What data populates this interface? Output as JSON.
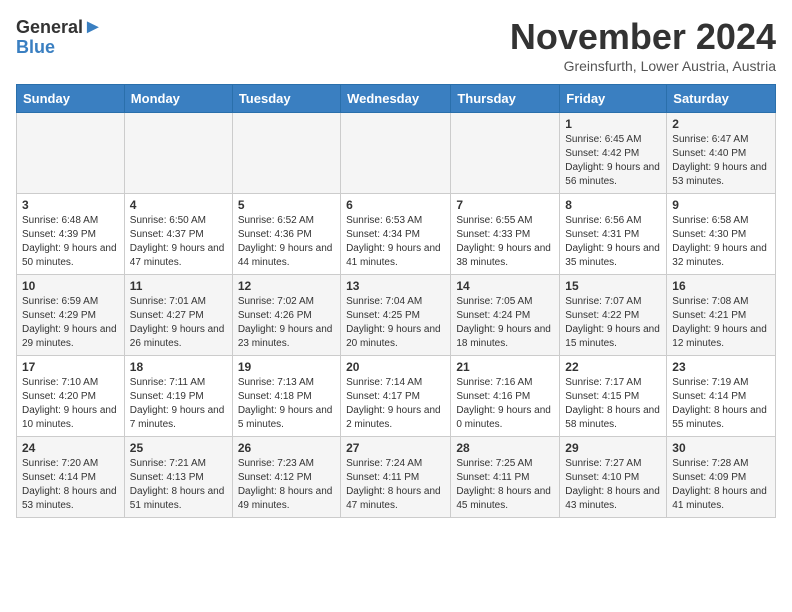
{
  "logo": {
    "line1": "General",
    "line2": "Blue"
  },
  "title": "November 2024",
  "subtitle": "Greinsfurth, Lower Austria, Austria",
  "headers": [
    "Sunday",
    "Monday",
    "Tuesday",
    "Wednesday",
    "Thursday",
    "Friday",
    "Saturday"
  ],
  "weeks": [
    [
      {
        "day": "",
        "info": ""
      },
      {
        "day": "",
        "info": ""
      },
      {
        "day": "",
        "info": ""
      },
      {
        "day": "",
        "info": ""
      },
      {
        "day": "",
        "info": ""
      },
      {
        "day": "1",
        "info": "Sunrise: 6:45 AM\nSunset: 4:42 PM\nDaylight: 9 hours and 56 minutes."
      },
      {
        "day": "2",
        "info": "Sunrise: 6:47 AM\nSunset: 4:40 PM\nDaylight: 9 hours and 53 minutes."
      }
    ],
    [
      {
        "day": "3",
        "info": "Sunrise: 6:48 AM\nSunset: 4:39 PM\nDaylight: 9 hours and 50 minutes."
      },
      {
        "day": "4",
        "info": "Sunrise: 6:50 AM\nSunset: 4:37 PM\nDaylight: 9 hours and 47 minutes."
      },
      {
        "day": "5",
        "info": "Sunrise: 6:52 AM\nSunset: 4:36 PM\nDaylight: 9 hours and 44 minutes."
      },
      {
        "day": "6",
        "info": "Sunrise: 6:53 AM\nSunset: 4:34 PM\nDaylight: 9 hours and 41 minutes."
      },
      {
        "day": "7",
        "info": "Sunrise: 6:55 AM\nSunset: 4:33 PM\nDaylight: 9 hours and 38 minutes."
      },
      {
        "day": "8",
        "info": "Sunrise: 6:56 AM\nSunset: 4:31 PM\nDaylight: 9 hours and 35 minutes."
      },
      {
        "day": "9",
        "info": "Sunrise: 6:58 AM\nSunset: 4:30 PM\nDaylight: 9 hours and 32 minutes."
      }
    ],
    [
      {
        "day": "10",
        "info": "Sunrise: 6:59 AM\nSunset: 4:29 PM\nDaylight: 9 hours and 29 minutes."
      },
      {
        "day": "11",
        "info": "Sunrise: 7:01 AM\nSunset: 4:27 PM\nDaylight: 9 hours and 26 minutes."
      },
      {
        "day": "12",
        "info": "Sunrise: 7:02 AM\nSunset: 4:26 PM\nDaylight: 9 hours and 23 minutes."
      },
      {
        "day": "13",
        "info": "Sunrise: 7:04 AM\nSunset: 4:25 PM\nDaylight: 9 hours and 20 minutes."
      },
      {
        "day": "14",
        "info": "Sunrise: 7:05 AM\nSunset: 4:24 PM\nDaylight: 9 hours and 18 minutes."
      },
      {
        "day": "15",
        "info": "Sunrise: 7:07 AM\nSunset: 4:22 PM\nDaylight: 9 hours and 15 minutes."
      },
      {
        "day": "16",
        "info": "Sunrise: 7:08 AM\nSunset: 4:21 PM\nDaylight: 9 hours and 12 minutes."
      }
    ],
    [
      {
        "day": "17",
        "info": "Sunrise: 7:10 AM\nSunset: 4:20 PM\nDaylight: 9 hours and 10 minutes."
      },
      {
        "day": "18",
        "info": "Sunrise: 7:11 AM\nSunset: 4:19 PM\nDaylight: 9 hours and 7 minutes."
      },
      {
        "day": "19",
        "info": "Sunrise: 7:13 AM\nSunset: 4:18 PM\nDaylight: 9 hours and 5 minutes."
      },
      {
        "day": "20",
        "info": "Sunrise: 7:14 AM\nSunset: 4:17 PM\nDaylight: 9 hours and 2 minutes."
      },
      {
        "day": "21",
        "info": "Sunrise: 7:16 AM\nSunset: 4:16 PM\nDaylight: 9 hours and 0 minutes."
      },
      {
        "day": "22",
        "info": "Sunrise: 7:17 AM\nSunset: 4:15 PM\nDaylight: 8 hours and 58 minutes."
      },
      {
        "day": "23",
        "info": "Sunrise: 7:19 AM\nSunset: 4:14 PM\nDaylight: 8 hours and 55 minutes."
      }
    ],
    [
      {
        "day": "24",
        "info": "Sunrise: 7:20 AM\nSunset: 4:14 PM\nDaylight: 8 hours and 53 minutes."
      },
      {
        "day": "25",
        "info": "Sunrise: 7:21 AM\nSunset: 4:13 PM\nDaylight: 8 hours and 51 minutes."
      },
      {
        "day": "26",
        "info": "Sunrise: 7:23 AM\nSunset: 4:12 PM\nDaylight: 8 hours and 49 minutes."
      },
      {
        "day": "27",
        "info": "Sunrise: 7:24 AM\nSunset: 4:11 PM\nDaylight: 8 hours and 47 minutes."
      },
      {
        "day": "28",
        "info": "Sunrise: 7:25 AM\nSunset: 4:11 PM\nDaylight: 8 hours and 45 minutes."
      },
      {
        "day": "29",
        "info": "Sunrise: 7:27 AM\nSunset: 4:10 PM\nDaylight: 8 hours and 43 minutes."
      },
      {
        "day": "30",
        "info": "Sunrise: 7:28 AM\nSunset: 4:09 PM\nDaylight: 8 hours and 41 minutes."
      }
    ]
  ]
}
